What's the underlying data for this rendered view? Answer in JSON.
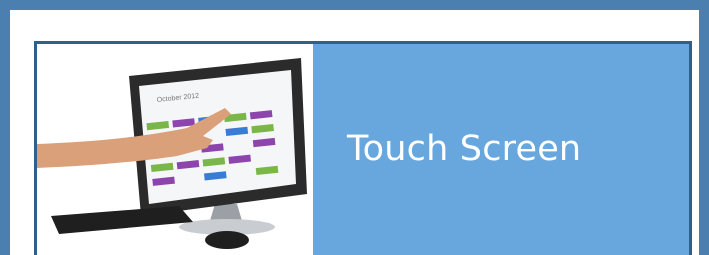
{
  "heading": {
    "text": "Touch Screen"
  },
  "image": {
    "description_icon": "touch-screen-computer-icon",
    "monitor_calendar_title": "October 2012"
  },
  "colors": {
    "outer_background": "#4a7fb0",
    "panel_background": "#ffffff",
    "card_background": "#67a7dd",
    "card_border": "#2f5f8a",
    "heading_text": "#ffffff"
  }
}
